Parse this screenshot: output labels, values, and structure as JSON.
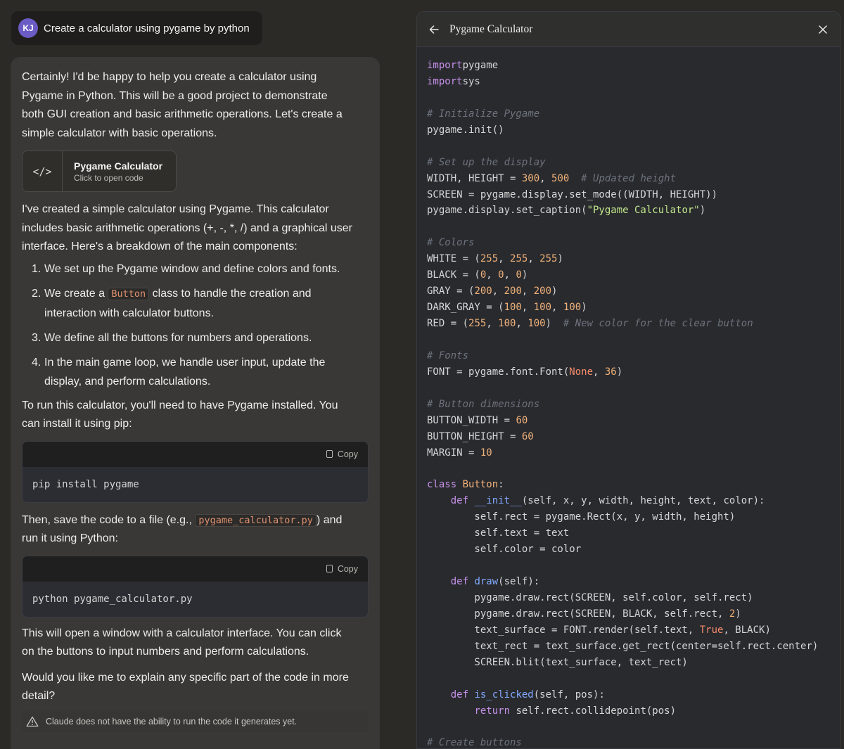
{
  "user": {
    "initials": "KJ",
    "message": "Create a calculator using pygame by python"
  },
  "assistant": {
    "intro": "Certainly! I'd be happy to help you create a calculator using Pygame in Python. This will be a good project to demonstrate both GUI creation and basic arithmetic operations. Let's create a simple calculator with basic operations.",
    "artifact": {
      "title": "Pygame Calculator",
      "subtitle": "Click to open code",
      "icon": "</>"
    },
    "summary": "I've created a simple calculator using Pygame. This calculator includes basic arithmetic operations (+, -, *, /) and a graphical user interface. Here's a breakdown of the main components:",
    "steps": [
      {
        "num": "1.",
        "text": "We set up the Pygame window and define colors and fonts."
      },
      {
        "num": "2.",
        "pre": "We create a ",
        "code": "Button",
        "post": " class to handle the creation and interaction with calculator buttons."
      },
      {
        "num": "3.",
        "text": "We define all the buttons for numbers and operations."
      },
      {
        "num": "4.",
        "text": "In the main game loop, we handle user input, update the display, and perform calculations."
      }
    ],
    "install_text": "To run this calculator, you'll need to have Pygame installed. You can install it using pip:",
    "copy_label": "Copy",
    "install_cmd": "pip install pygame",
    "save_pre": "Then, save the code to a file (e.g., ",
    "save_code": "pygame_calculator.py",
    "save_post": ") and run it using Python:",
    "run_cmd": "python pygame_calculator.py",
    "open_text": "This will open a window with a calculator interface. You can click on the buttons to input numbers and perform calculations.",
    "question": "Would you like me to explain any specific part of the code in more detail?",
    "notice": "Claude does not have the ability to run the code it generates yet."
  },
  "panel": {
    "title": "Pygame Calculator",
    "code_lines": [
      [
        [
          "kw",
          "import"
        ],
        [
          "",
          "pygame"
        ]
      ],
      [
        [
          "kw",
          "import"
        ],
        [
          "",
          "sys"
        ]
      ],
      [],
      [
        [
          "cm",
          "# Initialize Pygame"
        ]
      ],
      [
        [
          "",
          "pygame.init()"
        ]
      ],
      [],
      [
        [
          "cm",
          "# Set up the display"
        ]
      ],
      [
        [
          "",
          "WIDTH, HEIGHT = "
        ],
        [
          "nm",
          "300"
        ],
        [
          "",
          ", "
        ],
        [
          "nm",
          "500"
        ],
        [
          "",
          "  "
        ],
        [
          "cm",
          "# Updated height"
        ]
      ],
      [
        [
          "",
          "SCREEN = pygame.display.set_mode((WIDTH, HEIGHT))"
        ]
      ],
      [
        [
          "",
          "pygame.display.set_caption("
        ],
        [
          "st",
          "\"Pygame Calculator\""
        ],
        [
          "",
          ")"
        ]
      ],
      [],
      [
        [
          "cm",
          "# Colors"
        ]
      ],
      [
        [
          "",
          "WHITE = ("
        ],
        [
          "nm",
          "255"
        ],
        [
          "",
          ", "
        ],
        [
          "nm",
          "255"
        ],
        [
          "",
          ", "
        ],
        [
          "nm",
          "255"
        ],
        [
          "",
          ")"
        ]
      ],
      [
        [
          "",
          "BLACK = ("
        ],
        [
          "nm",
          "0"
        ],
        [
          "",
          ", "
        ],
        [
          "nm",
          "0"
        ],
        [
          "",
          ", "
        ],
        [
          "nm",
          "0"
        ],
        [
          "",
          ")"
        ]
      ],
      [
        [
          "",
          "GRAY = ("
        ],
        [
          "nm",
          "200"
        ],
        [
          "",
          ", "
        ],
        [
          "nm",
          "200"
        ],
        [
          "",
          ", "
        ],
        [
          "nm",
          "200"
        ],
        [
          "",
          ")"
        ]
      ],
      [
        [
          "",
          "DARK_GRAY = ("
        ],
        [
          "nm",
          "100"
        ],
        [
          "",
          ", "
        ],
        [
          "nm",
          "100"
        ],
        [
          "",
          ", "
        ],
        [
          "nm",
          "100"
        ],
        [
          "",
          ")"
        ]
      ],
      [
        [
          "",
          "RED = ("
        ],
        [
          "nm",
          "255"
        ],
        [
          "",
          ", "
        ],
        [
          "nm",
          "100"
        ],
        [
          "",
          ", "
        ],
        [
          "nm",
          "100"
        ],
        [
          "",
          ")  "
        ],
        [
          "cm",
          "# New color for the clear button"
        ]
      ],
      [],
      [
        [
          "cm",
          "# Fonts"
        ]
      ],
      [
        [
          "",
          "FONT = pygame.font.Font("
        ],
        [
          "bi",
          "None"
        ],
        [
          "",
          ", "
        ],
        [
          "nm",
          "36"
        ],
        [
          "",
          ")"
        ]
      ],
      [],
      [
        [
          "cm",
          "# Button dimensions"
        ]
      ],
      [
        [
          "",
          "BUTTON_WIDTH = "
        ],
        [
          "nm",
          "60"
        ]
      ],
      [
        [
          "",
          "BUTTON_HEIGHT = "
        ],
        [
          "nm",
          "60"
        ]
      ],
      [
        [
          "",
          "MARGIN = "
        ],
        [
          "nm",
          "10"
        ]
      ],
      [],
      [
        [
          "kw",
          "class"
        ],
        [
          "",
          ""
        ],
        [
          "nm",
          " Button"
        ],
        [
          "",
          ":"
        ]
      ],
      [
        [
          "",
          "    "
        ],
        [
          "kw",
          "def"
        ],
        [
          "",
          ""
        ],
        [
          "fn",
          " __init__"
        ],
        [
          "",
          "(self, x, y, width, height, text, color):"
        ]
      ],
      [
        [
          "",
          "        self.rect = pygame.Rect(x, y, width, height)"
        ]
      ],
      [
        [
          "",
          "        self.text = text"
        ]
      ],
      [
        [
          "",
          "        self.color = color"
        ]
      ],
      [],
      [
        [
          "",
          "    "
        ],
        [
          "kw",
          "def"
        ],
        [
          "fn",
          " draw"
        ],
        [
          "",
          "(self):"
        ]
      ],
      [
        [
          "",
          "        pygame.draw.rect(SCREEN, self.color, self.rect)"
        ]
      ],
      [
        [
          "",
          "        pygame.draw.rect(SCREEN, BLACK, self.rect, "
        ],
        [
          "nm",
          "2"
        ],
        [
          "",
          ")"
        ]
      ],
      [
        [
          "",
          "        text_surface = FONT.render(self.text, "
        ],
        [
          "bi",
          "True"
        ],
        [
          "",
          ", BLACK)"
        ]
      ],
      [
        [
          "",
          "        text_rect = text_surface.get_rect(center=self.rect.center)"
        ]
      ],
      [
        [
          "",
          "        SCREEN.blit(text_surface, text_rect)"
        ]
      ],
      [],
      [
        [
          "",
          "    "
        ],
        [
          "kw",
          "def"
        ],
        [
          "fn",
          " is_clicked"
        ],
        [
          "",
          "(self, pos):"
        ]
      ],
      [
        [
          "",
          "        "
        ],
        [
          "kw",
          "return"
        ],
        [
          "",
          " self.rect.collidepoint(pos)"
        ]
      ],
      [],
      [
        [
          "cm",
          "# Create buttons"
        ]
      ]
    ]
  }
}
